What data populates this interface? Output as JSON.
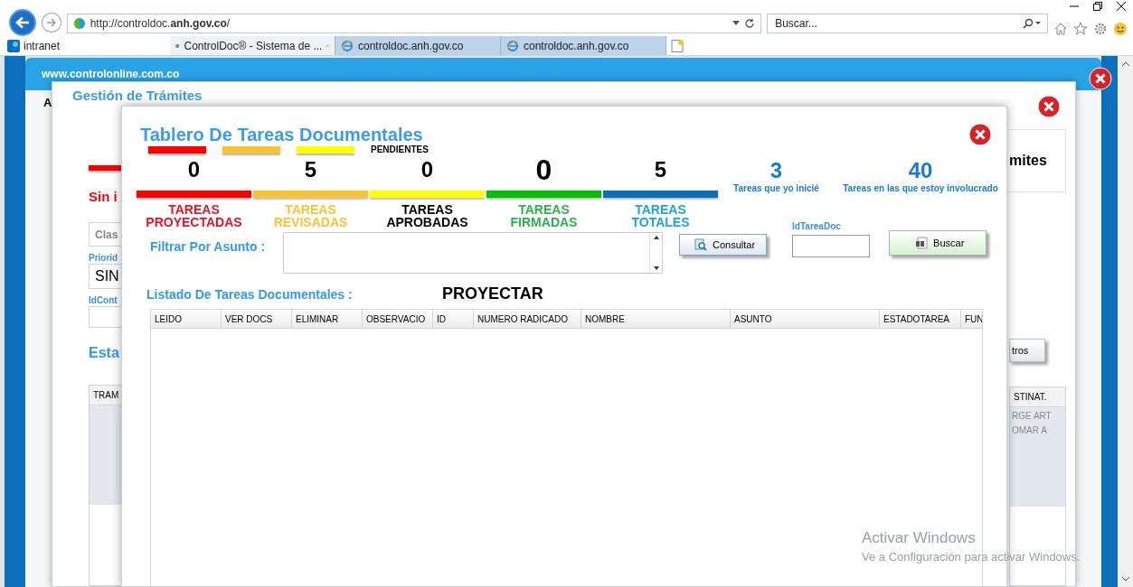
{
  "browser": {
    "address": "http://controldoc.**anh.gov.co**/",
    "search_placeholder": "Buscar...",
    "favorites": [
      {
        "label": "intranet"
      }
    ],
    "tabs": [
      {
        "label": "ControlDoc® - Sistema de ...",
        "kind": "site",
        "selected": true
      },
      {
        "label": "controldoc.anh.gov.co",
        "kind": "ie",
        "selected": false
      },
      {
        "label": "controldoc.anh.gov.co",
        "kind": "ie",
        "selected": false
      }
    ]
  },
  "outer_window": {
    "site": "www.controlonline.com.co",
    "tab_fragment": "A"
  },
  "tramites_window": {
    "title": "Gestión de Trámites",
    "left": {
      "alert": "Sin i",
      "class_placeholder": "Clas",
      "priority_label": "Priorid",
      "priority_value": "SIN",
      "id_label": "IdCont",
      "section_title": "Esta",
      "table_header": "TRAM"
    },
    "right": {
      "card_title": "mites",
      "button": "tros",
      "table_header": "STINAT.",
      "rows": [
        "RGE ART",
        "OMAR A"
      ]
    }
  },
  "dashboard": {
    "title": "Tablero De Tareas Documentales",
    "legend": [
      {
        "color": "#ff0000"
      },
      {
        "color": "#f9c332"
      },
      {
        "color": "#ffff00"
      }
    ],
    "legend_label": "PENDIENTES",
    "stats": [
      {
        "count": "0",
        "label": {
          "text": "TAREAS PROYECTADAS",
          "color": "#e8142a"
        },
        "color": "#ff0000",
        "emphasized": false
      },
      {
        "count": "5",
        "label": {
          "text": "TAREAS REVISADAS",
          "color": "#f9c332"
        },
        "color": "#f9c332",
        "emphasized": false
      },
      {
        "count": "0",
        "label": {
          "text": "TAREAS APROBADAS",
          "color": "#000000"
        },
        "color": "#ffff00",
        "emphasized": false
      },
      {
        "count": "0",
        "label": {
          "text": "TAREAS FIRMADAS",
          "color": "#2eb14a"
        },
        "color": "#00c000",
        "emphasized": true
      },
      {
        "count": "5",
        "label": {
          "text": "TAREAS TOTALES",
          "color": "#1ba3e6"
        },
        "color": "#0a6ebd",
        "emphasized": false
      }
    ],
    "metrics": [
      {
        "count": "3",
        "label": "Tareas que yo inicié"
      },
      {
        "count": "40",
        "label": "Tareas en las que estoy involucrado"
      }
    ],
    "filter_label": "Filtrar Por Asunto :",
    "consult_button": "Consultar",
    "id_label": "IdTareaDoc",
    "search_button": "Buscar",
    "list_title": "Listado De Tareas Documentales :",
    "list_mode": "PROYECTAR",
    "columns": [
      "LEIDO",
      "VER DOCS",
      "ELIMINAR",
      "OBSERVACIO",
      "ID",
      "NUMERO RADICADO",
      "NOMBRE",
      "ASUNTO",
      "ESTADOTAREA",
      "FUN"
    ]
  },
  "os_notice": {
    "title": "Activar Windows",
    "text": "Ve a Configuración para activar Windows."
  }
}
